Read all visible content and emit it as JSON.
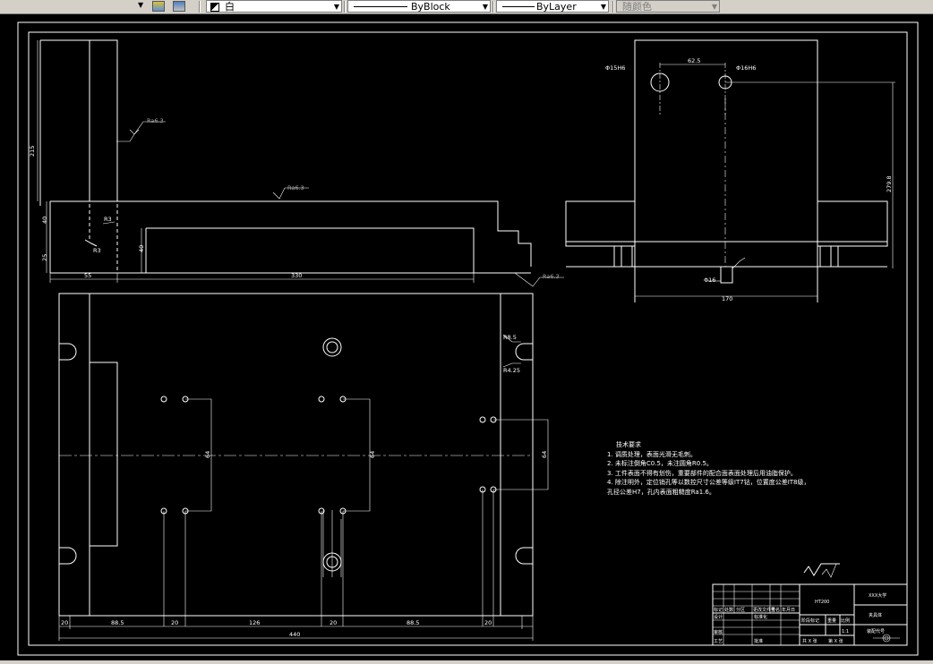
{
  "toolbar": {
    "color_select": "白",
    "linetype_label": "ByBlock",
    "lineweight_label": "ByLayer",
    "plotstyle_label": "随颜色"
  },
  "drawing": {
    "top_view_dims": {
      "height_left": "215",
      "h40": "40",
      "h25": "25",
      "h40b": "40",
      "w55": "55",
      "w330": "330",
      "r3": "R3",
      "r3b": "R3"
    },
    "roughness": {
      "r1": "Ra6.3",
      "r2": "Ra6.3",
      "r3": "Ra6.3"
    },
    "side_view_dims": {
      "hole1": "Φ15H6",
      "hole2": "Φ16H6",
      "spacing": "62.5",
      "height": "279.8",
      "width": "170",
      "small": "Φ16"
    },
    "plan_view_dims": {
      "r1": "R8.5",
      "r2": "R4.25",
      "d64a": "64",
      "d64b": "64",
      "d64c": "64",
      "b20a": "20",
      "b88": "88.5",
      "b20b": "20",
      "b126": "126",
      "b20c": "20",
      "b88b": "88.5",
      "b20d": "20",
      "total": "440"
    },
    "notes": {
      "title": "技术要求",
      "lines": [
        "1. 调质处理，表面光滑无毛刺。",
        "2. 未标注倒角C0.5，未注圆角R0.5。",
        "3. 工件表面不得有划伤，重要部件的配合面表面处理后用油脂保护。",
        "4. 除注明外，定位销孔等以数控尺寸公差等级IT7钻，位置度公差IT8级，",
        "孔径公差H7，孔内表面粗糙度Ra1.6。"
      ]
    },
    "title_block": {
      "material": "HT200",
      "school": "XXX大学",
      "part_name": "夹具体",
      "drawing_no": "装配代号",
      "scale": "1:1",
      "sheet": "共 X 张",
      "sheet_no": "第 X 张",
      "row_labels": [
        "标记",
        "设计",
        "审核",
        "工艺"
      ],
      "col_labels": [
        "处数",
        "分区",
        "更改文件号",
        "签名",
        "年月日"
      ],
      "stage_labels": [
        "阶段标记",
        "重量",
        "比例"
      ],
      "std": "标准化",
      "approve": "批准"
    }
  }
}
